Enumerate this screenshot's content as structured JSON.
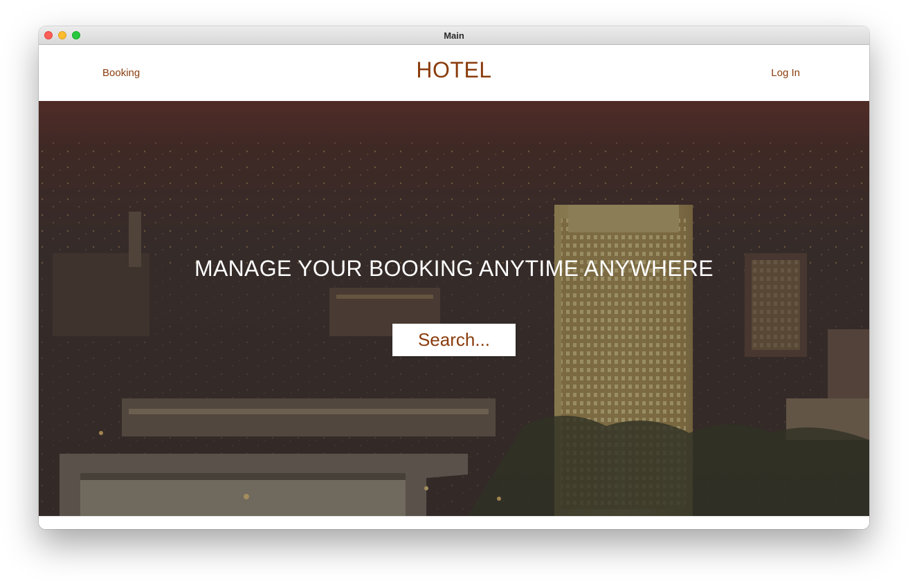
{
  "window": {
    "title": "Main"
  },
  "navbar": {
    "booking_label": "Booking",
    "brand": "HOTEL",
    "login_label": "Log In"
  },
  "hero": {
    "heading": "MANAGE YOUR BOOKING ANYTIME ANYWHERE",
    "search_label": "Search..."
  },
  "colors": {
    "accent": "#8a3c0c",
    "hero_overlay": "#302828"
  }
}
